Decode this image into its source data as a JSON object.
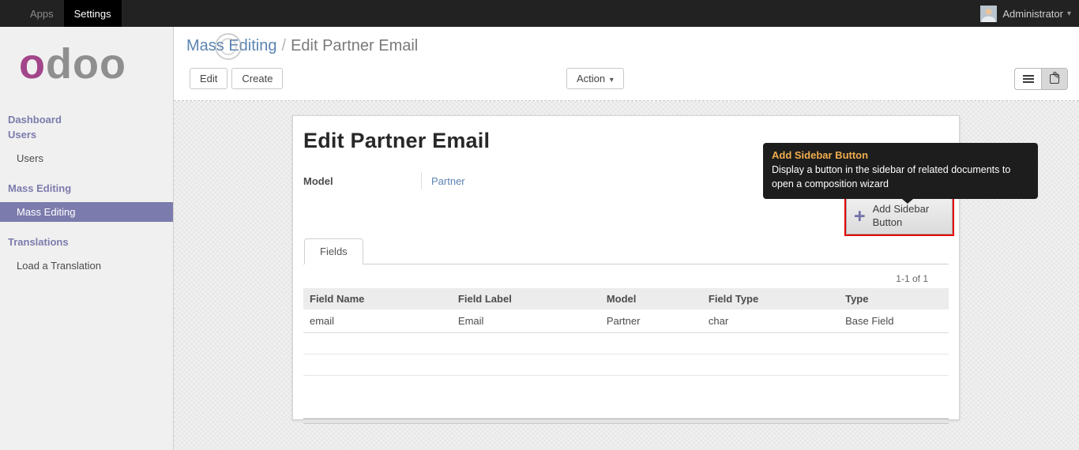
{
  "topbar": {
    "menu_apps": "Apps",
    "menu_settings": "Settings",
    "user_name": "Administrator"
  },
  "sidebar": {
    "logo_first": "o",
    "logo_rest": "doo",
    "sections": [
      {
        "heading": "Dashboard",
        "items": []
      },
      {
        "heading": "Users",
        "items": [
          {
            "label": "Users",
            "active": false
          }
        ]
      },
      {
        "heading": "Mass Editing",
        "items": [
          {
            "label": "Mass Editing",
            "active": true
          }
        ]
      },
      {
        "heading": "Translations",
        "items": [
          {
            "label": "Load a Translation",
            "active": false
          }
        ]
      }
    ]
  },
  "breadcrumb": {
    "parent": "Mass Editing",
    "separator": "/",
    "current": "Edit Partner Email"
  },
  "toolbar": {
    "edit_label": "Edit",
    "create_label": "Create",
    "action_label": "Action"
  },
  "form": {
    "title": "Edit Partner Email",
    "model_label": "Model",
    "model_value": "Partner",
    "add_button_label": "Add Sidebar Button",
    "tabs": [
      {
        "label": "Fields",
        "active": true
      }
    ],
    "pager": "1-1 of 1",
    "table": {
      "headers": [
        "Field Name",
        "Field Label",
        "Model",
        "Field Type",
        "Type"
      ],
      "rows": [
        [
          "email",
          "Email",
          "Partner",
          "char",
          "Base Field"
        ]
      ]
    }
  },
  "tooltip": {
    "title": "Add Sidebar Button",
    "body": "Display a button in the sidebar of related documents to open a composition wizard"
  },
  "icons": {
    "plus": "+",
    "caret_down": "▾",
    "list_view": "list-lines",
    "form_view": "pencil-square",
    "loading_spinner": "concentric-circles"
  },
  "colors": {
    "accent_purple": "#7c7bad",
    "logo_magenta": "#a24689",
    "link_blue": "#5b84b2",
    "highlight_red": "#e60000",
    "tooltip_gold": "#f0ad4e",
    "topbar_bg": "#222222",
    "topbar_active_bg": "#000000",
    "sidebar_bg": "#f0f0f0",
    "body_bg": "#f1f0f0"
  }
}
